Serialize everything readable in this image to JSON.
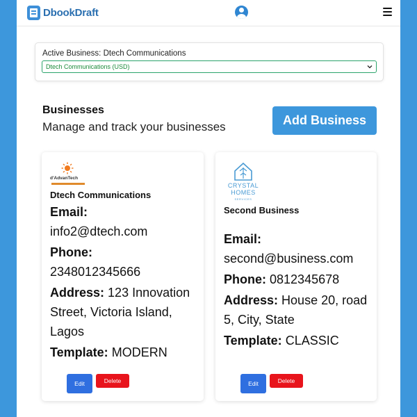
{
  "app": {
    "brand": "DbookDraft"
  },
  "active_business": {
    "label": "Active Business: Dtech Communications",
    "selected": "Dtech Communications (USD)"
  },
  "section": {
    "title": "Businesses",
    "subtitle": "Manage and track your businesses",
    "add_label": "Add Business"
  },
  "businesses": [
    {
      "logo_text": "d'AdvanTech",
      "name": "Dtech Communications",
      "email_label": "Email:",
      "email": "info2@dtech.com",
      "phone_label": "Phone:",
      "phone": "2348012345666",
      "address_label": "Address:",
      "address": "123 Innovation Street, Victoria Island, Lagos",
      "template_label": "Template:",
      "template": "MODERN",
      "edit_label": "Edit",
      "delete_label": "Delete"
    },
    {
      "logo_text": "CRYSTAL HOMES",
      "logo_sub": "SERVICES",
      "name": "Second Business",
      "email_label": "Email:",
      "email": "second@business.com",
      "phone_label": "Phone:",
      "phone": "0812345678",
      "address_label": "Address:",
      "address": "House 20, road 5, City, State",
      "template_label": "Template:",
      "template": "CLASSIC",
      "edit_label": "Edit",
      "delete_label": "Delete"
    }
  ],
  "colors": {
    "accent": "#3d97dc",
    "edit": "#2f6fe0",
    "delete": "#e8141c"
  },
  "icons": {
    "brand": "document-icon",
    "profile": "user-circle-icon",
    "menu": "hamburger-menu-icon"
  }
}
